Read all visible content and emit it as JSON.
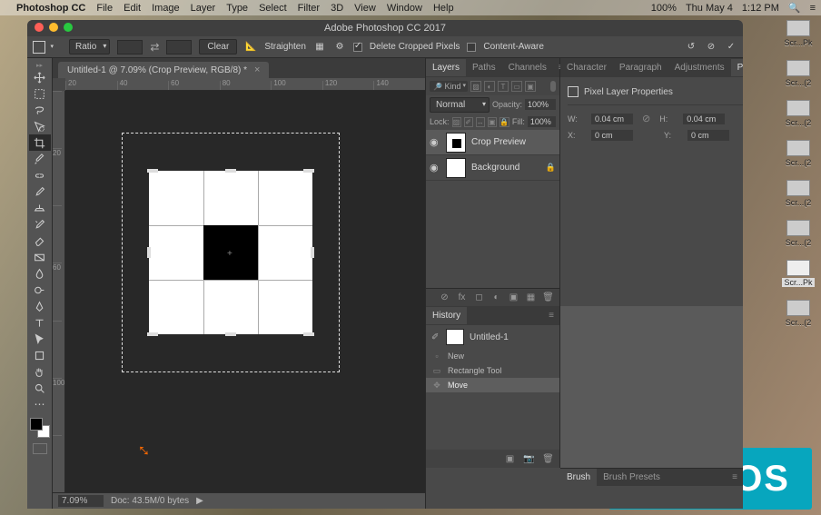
{
  "menubar": {
    "app": "Photoshop CC",
    "items": [
      "File",
      "Edit",
      "Image",
      "Layer",
      "Type",
      "Select",
      "Filter",
      "3D",
      "View",
      "Window",
      "Help"
    ],
    "right": {
      "percent": "100%",
      "battery": "",
      "day_date": "Thu May 4",
      "time": "1:12 PM"
    }
  },
  "desktop": {
    "icons": [
      {
        "label": "Scr...Pk"
      },
      {
        "label": "Scr...(2"
      },
      {
        "label": "Scr...(2"
      },
      {
        "label": "Scr...(2"
      },
      {
        "label": "Scr...(2"
      },
      {
        "label": "Scr...(2"
      },
      {
        "label": "Scr...Pk"
      },
      {
        "label": "Scr...(2"
      }
    ]
  },
  "twos": {
    "text": "TWOS"
  },
  "window": {
    "title": "Adobe Photoshop CC 2017"
  },
  "options": {
    "ratio_mode": "Ratio",
    "clear_btn": "Clear",
    "straighten": "Straighten",
    "delete_cropped": "Delete Cropped Pixels",
    "content_aware": "Content-Aware"
  },
  "doc_tab": {
    "title": "Untitled-1 @ 7.09% (Crop Preview, RGB/8) *",
    "close": "×"
  },
  "ruler": {
    "h": [
      "20",
      "40",
      "60",
      "80",
      "100",
      "120",
      "140"
    ],
    "v": [
      "",
      "20",
      "",
      "60",
      "",
      "100",
      ""
    ]
  },
  "status": {
    "zoom": "7.09%",
    "doc": "Doc: 43.5M/0 bytes",
    "arrow": "▶"
  },
  "tools": [
    "move",
    "rect-marquee",
    "lasso",
    "magic-wand",
    "crop",
    "eyedropper",
    "spot-heal",
    "brush",
    "clone",
    "history-brush",
    "eraser",
    "gradient",
    "blur",
    "dodge",
    "pen",
    "type",
    "path-select",
    "rectangle",
    "hand",
    "zoom",
    "more"
  ],
  "tools_active": "crop",
  "panels": {
    "layers_tabs": [
      "Layers",
      "Paths",
      "Channels"
    ],
    "right_top_tabs": [
      "Character",
      "Paragraph",
      "Adjustments",
      "Properties"
    ],
    "layers": {
      "filter_kind": "Kind",
      "blend_mode": "Normal",
      "opacity_label": "Opacity:",
      "opacity": "100%",
      "lock_label": "Lock:",
      "fill_label": "Fill:",
      "fill": "100%",
      "items": [
        {
          "name": "Crop Preview",
          "eye": "◉",
          "selected": true,
          "inner": true
        },
        {
          "name": "Background",
          "eye": "◉",
          "locked": true
        }
      ]
    },
    "history": {
      "tab": "History",
      "snapshot": "Untitled-1",
      "items": [
        {
          "icon": "▫",
          "name": "New"
        },
        {
          "icon": "▭",
          "name": "Rectangle Tool"
        },
        {
          "icon": "✥",
          "name": "Move",
          "selected": true
        }
      ]
    },
    "properties": {
      "heading": "Pixel Layer Properties",
      "w_label": "W:",
      "w": "0.04 cm",
      "link": "⊘",
      "h_label": "H:",
      "h": "0.04 cm",
      "x_label": "X:",
      "x": "0 cm",
      "y_label": "Y:",
      "y": "0 cm"
    },
    "brush_tabs": [
      "Brush",
      "Brush Presets"
    ]
  }
}
